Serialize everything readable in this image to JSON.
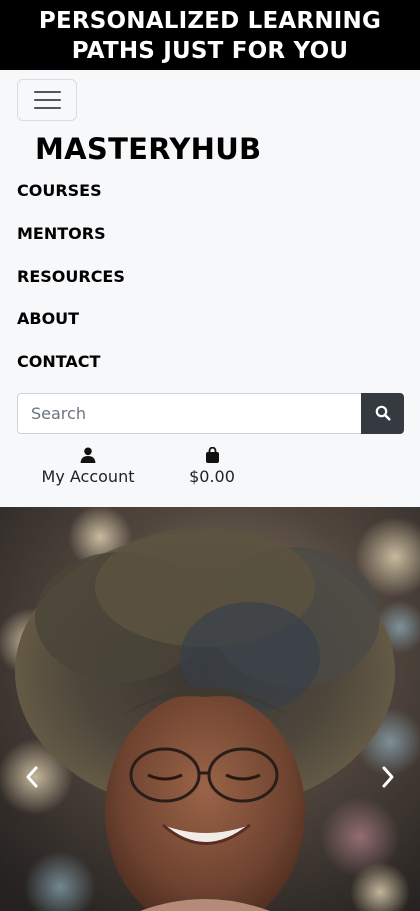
{
  "promo": {
    "line1": "PERSONALIZED LEARNING",
    "line2": "PATHS JUST FOR YOU"
  },
  "header": {
    "brand": "MASTERYHUB",
    "menu_icon": "hamburger-icon"
  },
  "nav": {
    "items": [
      {
        "label": "COURSES"
      },
      {
        "label": "MENTORS"
      },
      {
        "label": "RESOURCES"
      },
      {
        "label": "ABOUT"
      },
      {
        "label": "CONTACT"
      }
    ]
  },
  "search": {
    "placeholder": "Search",
    "value": "",
    "icon": "search-icon"
  },
  "account": {
    "label": "My Account",
    "icon": "user-icon"
  },
  "cart": {
    "total": "$0.00",
    "icon": "shopping-bag-icon"
  },
  "hero": {
    "image": "smiling-woman-photo",
    "prev_icon": "chevron-left-icon",
    "next_icon": "chevron-right-icon"
  },
  "colors": {
    "promo_bg": "#000000",
    "search_button": "#343a40",
    "page_bg": "#f7f8fa"
  }
}
